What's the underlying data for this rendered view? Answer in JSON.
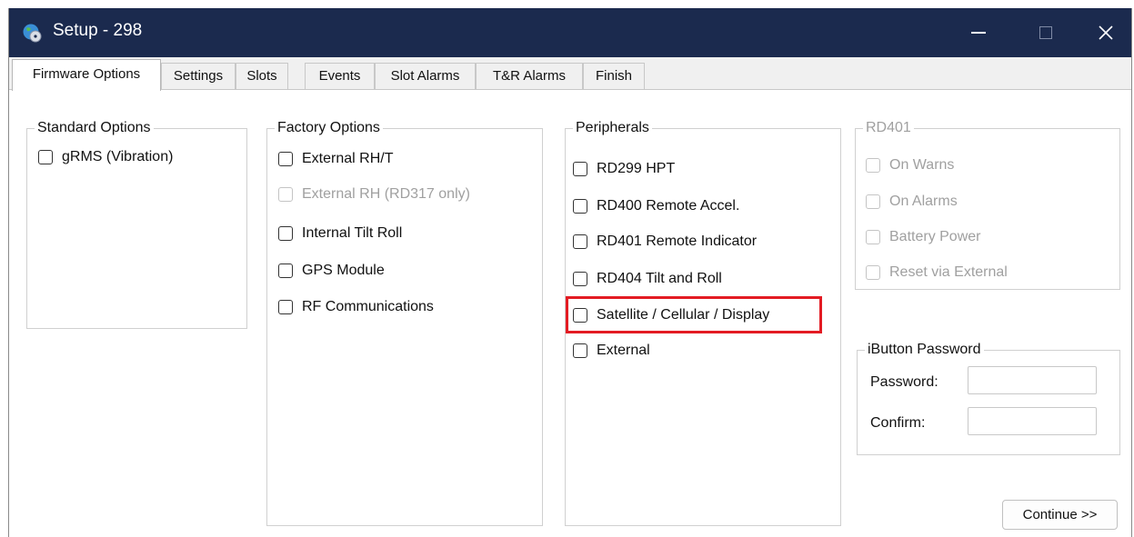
{
  "window": {
    "title": "Setup - 298",
    "icon": "globe-cd-icon"
  },
  "tabs": [
    {
      "label": "Firmware Options",
      "active": true
    },
    {
      "label": "Settings",
      "active": false
    },
    {
      "label": "Slots",
      "active": false
    },
    {
      "label": "Events",
      "active": false
    },
    {
      "label": "Slot Alarms",
      "active": false
    },
    {
      "label": "T&R Alarms",
      "active": false
    },
    {
      "label": "Finish",
      "active": false
    }
  ],
  "standard_options": {
    "title": "Standard Options",
    "items": [
      {
        "label": "gRMS (Vibration)",
        "checked": false,
        "enabled": true
      }
    ]
  },
  "factory_options": {
    "title": "Factory Options",
    "items": [
      {
        "label": "External RH/T",
        "checked": false,
        "enabled": true
      },
      {
        "label": "External RH (RD317 only)",
        "checked": false,
        "enabled": false
      },
      {
        "label": "Internal Tilt  Roll",
        "checked": false,
        "enabled": true
      },
      {
        "label": "GPS Module",
        "checked": false,
        "enabled": true
      },
      {
        "label": "RF Communications",
        "checked": false,
        "enabled": true
      }
    ]
  },
  "peripherals": {
    "title": "Peripherals",
    "items": [
      {
        "label": "RD299 HPT",
        "checked": false,
        "enabled": true
      },
      {
        "label": "RD400 Remote Accel.",
        "checked": false,
        "enabled": true
      },
      {
        "label": "RD401 Remote Indicator",
        "checked": false,
        "enabled": true
      },
      {
        "label": "RD404 Tilt and Roll",
        "checked": false,
        "enabled": true
      },
      {
        "label": "Satellite / Cellular / Display",
        "checked": false,
        "enabled": true,
        "highlighted": true
      },
      {
        "label": "External",
        "checked": false,
        "enabled": true
      }
    ]
  },
  "rd401": {
    "title": "RD401",
    "enabled": false,
    "items": [
      {
        "label": "On Warns",
        "checked": false,
        "enabled": false
      },
      {
        "label": "On Alarms",
        "checked": false,
        "enabled": false
      },
      {
        "label": "Battery Power",
        "checked": false,
        "enabled": false
      },
      {
        "label": "Reset via External",
        "checked": false,
        "enabled": false
      }
    ]
  },
  "ibutton": {
    "title": "iButton Password",
    "password_label": "Password:",
    "confirm_label": "Confirm:",
    "password_value": "",
    "confirm_value": ""
  },
  "continue_label": "Continue >>",
  "colors": {
    "titlebar": "#1b2a4e",
    "highlight": "#e31b23"
  }
}
